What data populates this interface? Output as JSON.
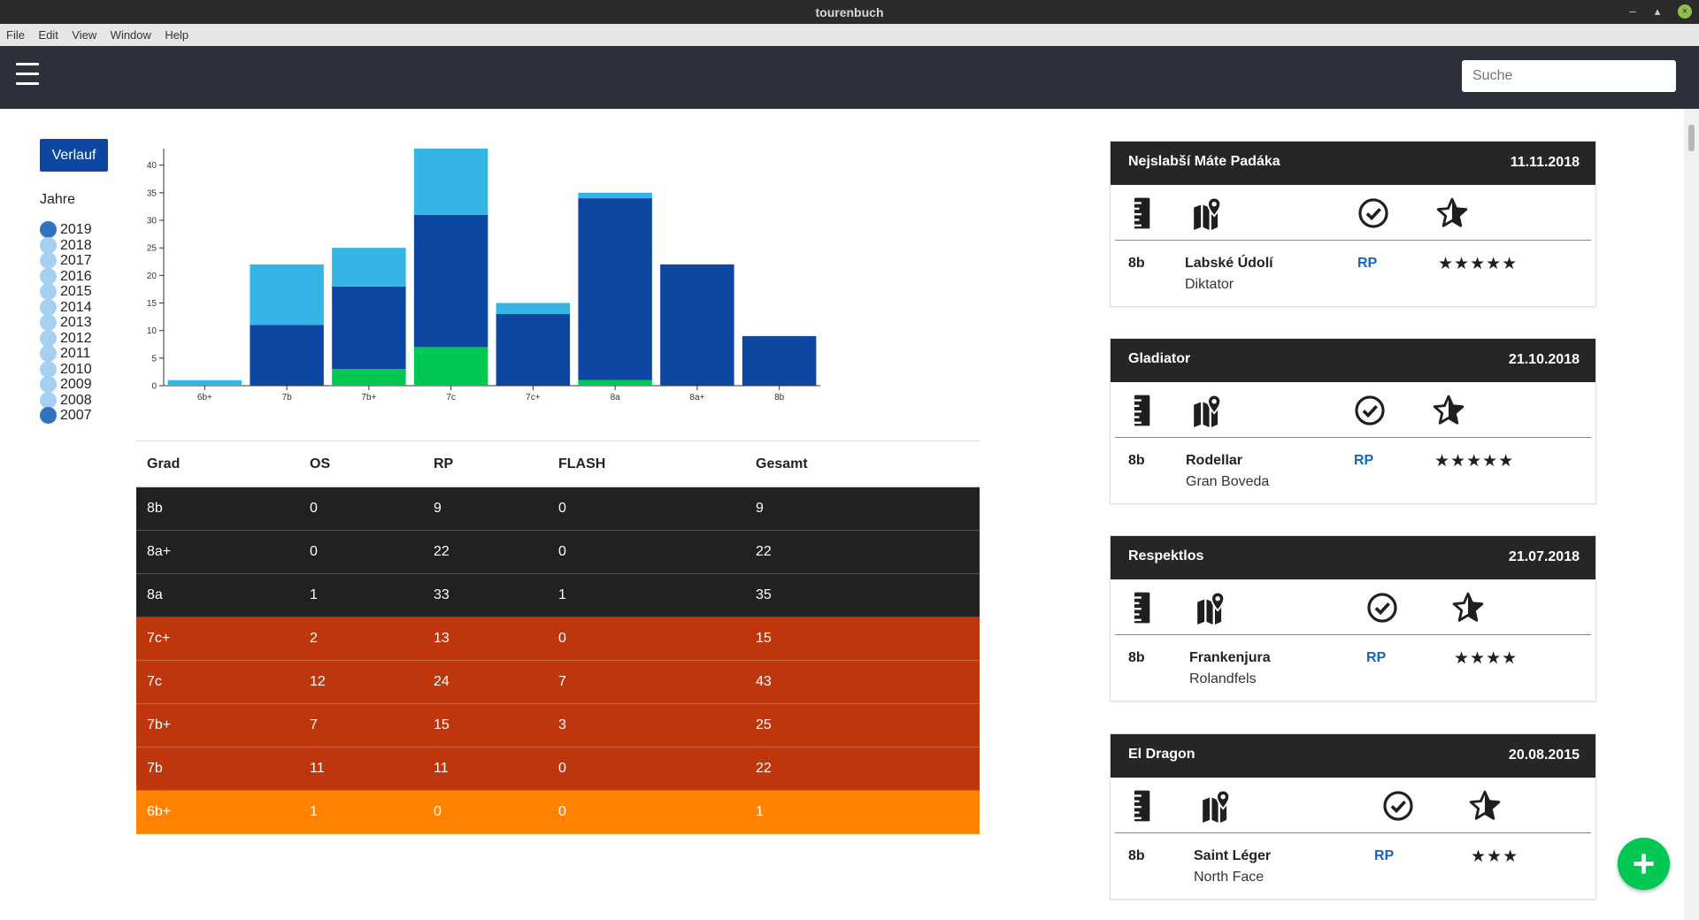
{
  "window": {
    "title": "tourenbuch",
    "minimize": "–",
    "maximize": "▴",
    "close": "×"
  },
  "menu": [
    "File",
    "Edit",
    "View",
    "Window",
    "Help"
  ],
  "header": {
    "search_placeholder": "Suche"
  },
  "sidebar": {
    "verlauf_label": "Verlauf",
    "jahre_label": "Jahre",
    "years": [
      {
        "label": "2019",
        "selected": true
      },
      {
        "label": "2018",
        "selected": false
      },
      {
        "label": "2017",
        "selected": false
      },
      {
        "label": "2016",
        "selected": false
      },
      {
        "label": "2015",
        "selected": false
      },
      {
        "label": "2014",
        "selected": false
      },
      {
        "label": "2013",
        "selected": false
      },
      {
        "label": "2012",
        "selected": false
      },
      {
        "label": "2011",
        "selected": false
      },
      {
        "label": "2010",
        "selected": false
      },
      {
        "label": "2009",
        "selected": false
      },
      {
        "label": "2008",
        "selected": false
      },
      {
        "label": "2007",
        "selected": true
      }
    ]
  },
  "colors": {
    "dark_blue": "#0d47a1",
    "light_blue": "#35b4e6",
    "green": "#00c853",
    "table_dark": "#212121",
    "table_red": "#bf360c",
    "table_orange": "#ff8200"
  },
  "chart_data": {
    "type": "bar",
    "stacked": true,
    "categories": [
      "6b+",
      "7b",
      "7b+",
      "7c",
      "7c+",
      "8a",
      "8a+",
      "8b"
    ],
    "series": [
      {
        "values": [
          0,
          0,
          3,
          7,
          0,
          1,
          0,
          0
        ],
        "color": "#00c853"
      },
      {
        "values": [
          0,
          11,
          15,
          24,
          13,
          33,
          22,
          9
        ],
        "color": "#0d47a1"
      },
      {
        "values": [
          1,
          11,
          7,
          12,
          2,
          1,
          0,
          0
        ],
        "color": "#35b4e6"
      }
    ],
    "ylim": [
      0,
      43
    ],
    "yticks": [
      0,
      5,
      10,
      15,
      20,
      25,
      30,
      35,
      40
    ],
    "title": "",
    "xlabel": "",
    "ylabel": ""
  },
  "table": {
    "headers": [
      "Grad",
      "OS",
      "RP",
      "FLASH",
      "Gesamt"
    ],
    "rows": [
      {
        "cells": [
          "8b",
          "0",
          "9",
          "0",
          "9"
        ],
        "color": "#212121"
      },
      {
        "cells": [
          "8a+",
          "0",
          "22",
          "0",
          "22"
        ],
        "color": "#212121"
      },
      {
        "cells": [
          "8a",
          "1",
          "33",
          "1",
          "35"
        ],
        "color": "#212121"
      },
      {
        "cells": [
          "7c+",
          "2",
          "13",
          "0",
          "15"
        ],
        "color": "#bf360c"
      },
      {
        "cells": [
          "7c",
          "12",
          "24",
          "7",
          "43"
        ],
        "color": "#bf360c"
      },
      {
        "cells": [
          "7b+",
          "7",
          "15",
          "3",
          "25"
        ],
        "color": "#bf360c"
      },
      {
        "cells": [
          "7b",
          "11",
          "11",
          "0",
          "22"
        ],
        "color": "#bf360c"
      },
      {
        "cells": [
          "6b+",
          "1",
          "0",
          "0",
          "1"
        ],
        "color": "#ff8200"
      }
    ]
  },
  "icons": [
    "ruler-icon",
    "map-marker-icon",
    "check-circle-icon",
    "star-outline-icon"
  ],
  "cards": [
    {
      "name": "Nejslabší Máte Padáka",
      "date": "11.11.2018",
      "grade": "8b",
      "area": "Labské Údolí",
      "route": "Diktator",
      "style": "RP",
      "stars": "★★★★★",
      "star_count": 5
    },
    {
      "name": "Gladiator",
      "date": "21.10.2018",
      "grade": "8b",
      "area": "Rodellar",
      "route": "Gran Boveda",
      "style": "RP",
      "stars": "★★★★★",
      "star_count": 5
    },
    {
      "name": "Respektlos",
      "date": "21.07.2018",
      "grade": "8b",
      "area": "Frankenjura",
      "route": "Rolandfels",
      "style": "RP",
      "stars": "★★★★",
      "star_count": 4
    },
    {
      "name": "El Dragon",
      "date": "20.08.2015",
      "grade": "8b",
      "area": "Saint Léger",
      "route": "North Face",
      "style": "RP",
      "stars": "★★★",
      "star_count": 3
    }
  ],
  "fab_label": "+"
}
